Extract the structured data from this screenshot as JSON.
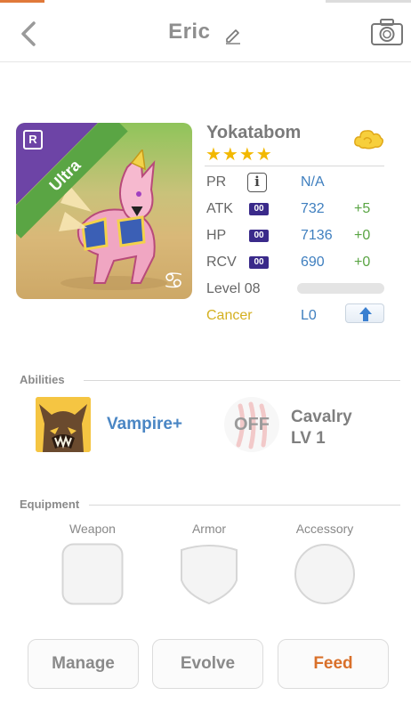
{
  "header": {
    "title": "Eric"
  },
  "monster": {
    "name": "Yokatabom",
    "stars": "★★★★",
    "rarity_badge": "R",
    "tier_ribbon": "Ultra",
    "zodiac_glyph": "♋"
  },
  "stats": {
    "pr": {
      "label": "PR",
      "info_glyph": "i",
      "value": "N/A"
    },
    "atk": {
      "label": "ATK",
      "chip": "00",
      "value": "732",
      "bonus": "+5"
    },
    "hp": {
      "label": "HP",
      "chip": "00",
      "value": "7136",
      "bonus": "+0"
    },
    "rcv": {
      "label": "RCV",
      "chip": "00",
      "value": "690",
      "bonus": "+0"
    },
    "level": {
      "label": "Level 08",
      "xp_fraction": 0.0
    },
    "sign": {
      "label": "Cancer",
      "value": "L0"
    }
  },
  "abilities": {
    "section_title": "Abilities",
    "items": [
      {
        "name": "Vampire+",
        "icon": "werewolf-icon"
      },
      {
        "status": "OFF",
        "name_line1": "Cavalry",
        "name_line2": "LV 1",
        "icon": "claw-scratch-icon"
      }
    ]
  },
  "equipment": {
    "section_title": "Equipment",
    "slots": [
      {
        "label": "Weapon"
      },
      {
        "label": "Armor"
      },
      {
        "label": "Accessory"
      }
    ]
  },
  "actions": {
    "manage": "Manage",
    "evolve": "Evolve",
    "feed": "Feed"
  },
  "colors": {
    "value_blue": "#3f7fbf",
    "bonus_green": "#5aa544",
    "star_gold": "#f2b800",
    "feed_orange": "#d9702a",
    "sign_gold": "#d4b020"
  }
}
